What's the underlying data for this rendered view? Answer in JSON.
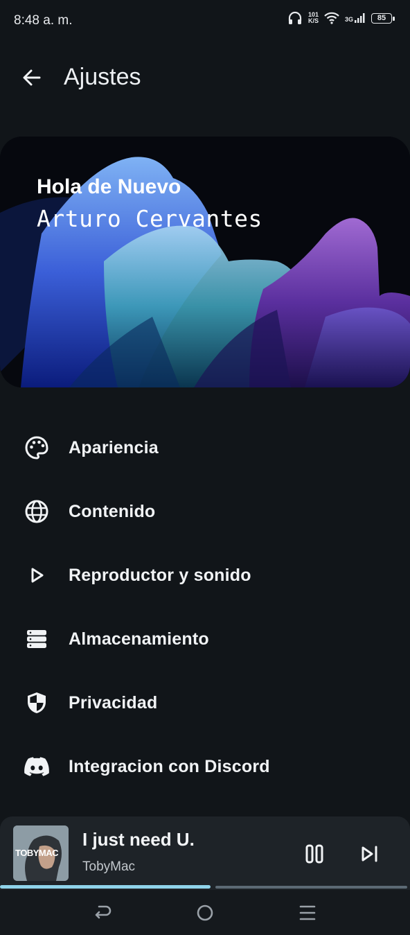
{
  "status_bar": {
    "time": "8:48 a. m.",
    "speed_value": "101",
    "speed_unit": "K/S",
    "network": "3G",
    "battery": "85"
  },
  "header": {
    "title": "Ajustes",
    "back_icon": "arrow-left-icon"
  },
  "hero": {
    "greeting": "Hola de Nuevo",
    "name": "Arturo Cervantes"
  },
  "menu": {
    "items": [
      {
        "label": "Apariencia",
        "icon": "palette-icon"
      },
      {
        "label": "Contenido",
        "icon": "globe-icon"
      },
      {
        "label": "Reproductor y sonido",
        "icon": "play-icon"
      },
      {
        "label": "Almacenamiento",
        "icon": "storage-icon"
      },
      {
        "label": "Privacidad",
        "icon": "shield-icon"
      },
      {
        "label": "Integracion con Discord",
        "icon": "discord-icon"
      }
    ]
  },
  "player": {
    "title": "I just need U.",
    "artist": "TobyMac",
    "album_text": "TOBYMAC",
    "progress": 0.515,
    "pause_icon": "pause-icon",
    "next_icon": "skip-next-icon"
  },
  "nav": {
    "back_icon": "nav-back-icon",
    "home_icon": "nav-home-icon",
    "recents_icon": "nav-recents-icon"
  },
  "colors": {
    "background": "#111519",
    "player_bg": "#1e2328",
    "progress": "#8fd3ea",
    "text": "#f1f3f5"
  }
}
